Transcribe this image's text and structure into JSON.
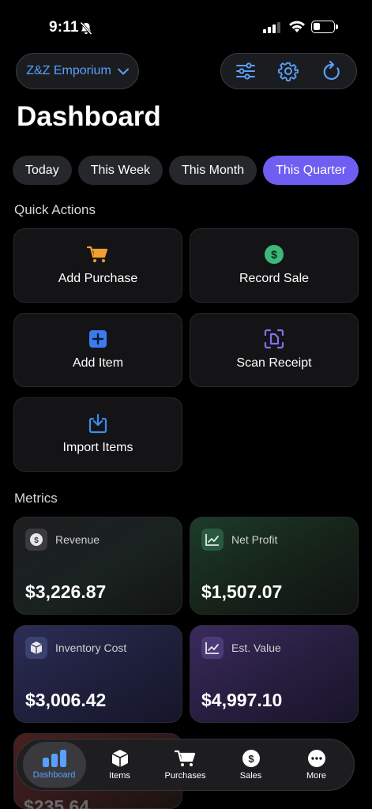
{
  "status_bar": {
    "time": "9:11"
  },
  "header": {
    "store_name": "Z&Z Emporium",
    "title": "Dashboard"
  },
  "periods": [
    "Today",
    "This Week",
    "This Month",
    "This Quarter"
  ],
  "active_period": "This Quarter",
  "quick_actions": {
    "label": "Quick Actions",
    "items": [
      {
        "label": "Add Purchase",
        "icon": "cart-icon",
        "color": "#f0a030"
      },
      {
        "label": "Record Sale",
        "icon": "dollar-icon",
        "color": "#3cb878"
      },
      {
        "label": "Add Item",
        "icon": "plus-square-icon",
        "color": "#3a7bf0"
      },
      {
        "label": "Scan Receipt",
        "icon": "scan-document-icon",
        "color": "#8a6cf0"
      },
      {
        "label": "Import Items",
        "icon": "import-tray-icon",
        "color": "#3a8cf0"
      }
    ]
  },
  "metrics": {
    "label": "Metrics",
    "items": [
      {
        "label": "Revenue",
        "value": "$3,226.87",
        "icon": "dollar-icon"
      },
      {
        "label": "Net Profit",
        "value": "$1,507.07",
        "icon": "trend-chart-icon"
      },
      {
        "label": "Inventory Cost",
        "value": "$3,006.42",
        "icon": "box-icon"
      },
      {
        "label": "Est. Value",
        "value": "$4,997.10",
        "icon": "trend-chart-icon"
      }
    ],
    "partial_value": "$235.64"
  },
  "tabbar": {
    "items": [
      {
        "label": "Dashboard",
        "icon": "bar-chart-icon"
      },
      {
        "label": "Items",
        "icon": "box-icon"
      },
      {
        "label": "Purchases",
        "icon": "cart-icon"
      },
      {
        "label": "Sales",
        "icon": "dollar-circle-icon"
      },
      {
        "label": "More",
        "icon": "more-icon"
      }
    ]
  },
  "colors": {
    "accent": "#5aa0ff",
    "active_chip": "#6e5ff2"
  }
}
